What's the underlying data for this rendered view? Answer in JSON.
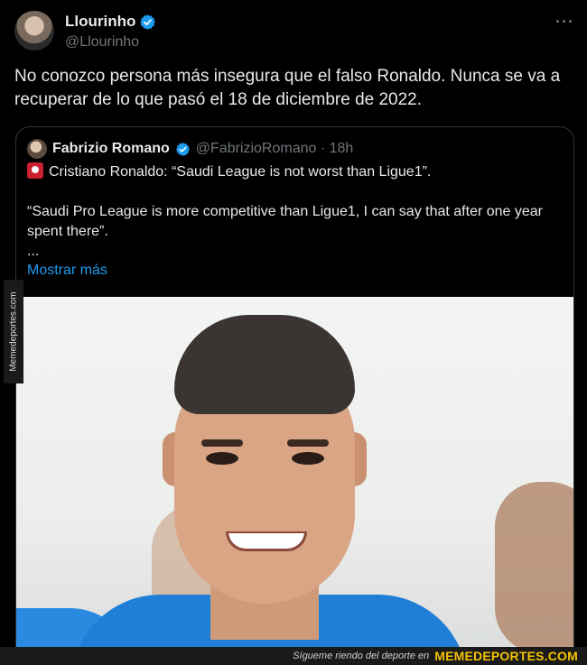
{
  "tweet": {
    "author": {
      "name": "Llourinho",
      "handle": "@Llourinho"
    },
    "text": "No conozco persona más insegura que el falso Ronaldo. Nunca se va a recuperar de lo que pasó el 18 de diciembre de 2022.",
    "more_icon": "···"
  },
  "quote": {
    "author": {
      "name": "Fabrizio Romano",
      "handle": "@FabrizioRomano · 18h"
    },
    "line1": "Cristiano Ronaldo: “Saudi League is not worst than Ligue1”.",
    "line2": "“Saudi Pro League is more competitive than Ligue1, I can say that after one year spent there”.",
    "ellipsis": "...",
    "show_more": "Mostrar más",
    "siren_icon": "siren-icon"
  },
  "watermark": {
    "side": "Memedeportes.com",
    "footer_text": "Sígueте riendo del deporte en",
    "footer_brand": "MEMEDEPORTES.COM"
  },
  "colors": {
    "background": "#000000",
    "text": "#e7e9ea",
    "muted": "#71767b",
    "link": "#1d9bf0",
    "verified": "#1d9bf0",
    "brand": "#f2c200"
  }
}
